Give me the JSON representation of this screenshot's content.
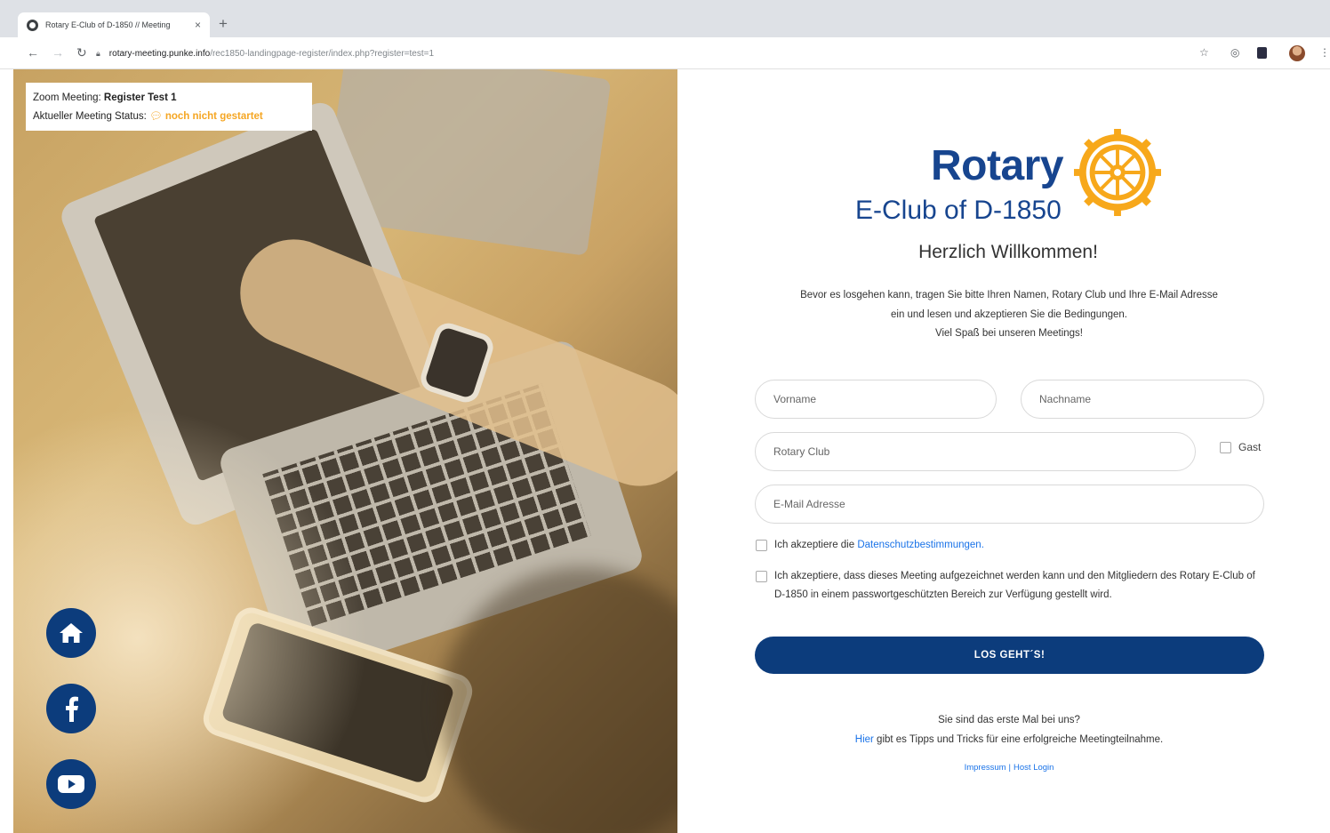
{
  "browser": {
    "tab_title": "Rotary E-Club of D-1850 // Meeting",
    "tab_close": "×",
    "new_tab": "+",
    "url_host": "rotary-meeting.punke.info",
    "url_path": "/rec1850-landingpage-register/index.php?register=test=1",
    "icons": [
      "back-arrow-icon",
      "forward-arrow-icon",
      "reload-icon",
      "lock-icon",
      "star-icon",
      "extension-icon",
      "profile-avatar",
      "menu-dots-icon"
    ]
  },
  "meeting": {
    "label": "Zoom Meeting:",
    "name": "Register Test 1",
    "status_label": "Aktueller Meeting Status:",
    "status_value": "noch nicht gestartet",
    "status_color": "#f5a623"
  },
  "logo": {
    "word": "Rotary",
    "subtitle": "E-Club of D-1850",
    "brand_blue": "#17458f",
    "brand_gold": "#f7a81b"
  },
  "form": {
    "welcome": "Herzlich Willkommen!",
    "intro_line1": "Bevor es losgehen kann, tragen Sie bitte Ihren Namen, Rotary Club und Ihre E-Mail Adresse",
    "intro_line2": "ein und lesen und akzeptieren Sie die Bedingungen.",
    "intro_line3": "Viel Spaß bei unseren Meetings!",
    "firstname_placeholder": "Vorname",
    "lastname_placeholder": "Nachname",
    "club_placeholder": "Rotary Club",
    "guest_label": "Gast",
    "email_placeholder": "E-Mail Adresse",
    "privacy_prefix": "Ich akzeptiere die ",
    "privacy_link": "Datenschutzbestimmungen",
    "privacy_suffix": ".",
    "recording_text": "Ich akzeptiere, dass dieses Meeting aufgezeichnet werden kann und den Mitgliedern des Rotary E-Club of D-1850 in einem passwortgeschützten Bereich zur Verfügung gestellt wird.",
    "submit_label": "LOS GEHT´S!",
    "button_color": "#0c3c7c"
  },
  "first_time": {
    "question": "Sie sind das erste Mal bei uns?",
    "link": "Hier",
    "rest": " gibt es Tipps und Tricks für eine erfolgreiche Meetingteilnahme."
  },
  "footer": {
    "impressum": "Impressum",
    "separator": "|",
    "host_login": "Host Login"
  },
  "social": [
    "home-icon",
    "facebook-icon",
    "youtube-icon"
  ]
}
